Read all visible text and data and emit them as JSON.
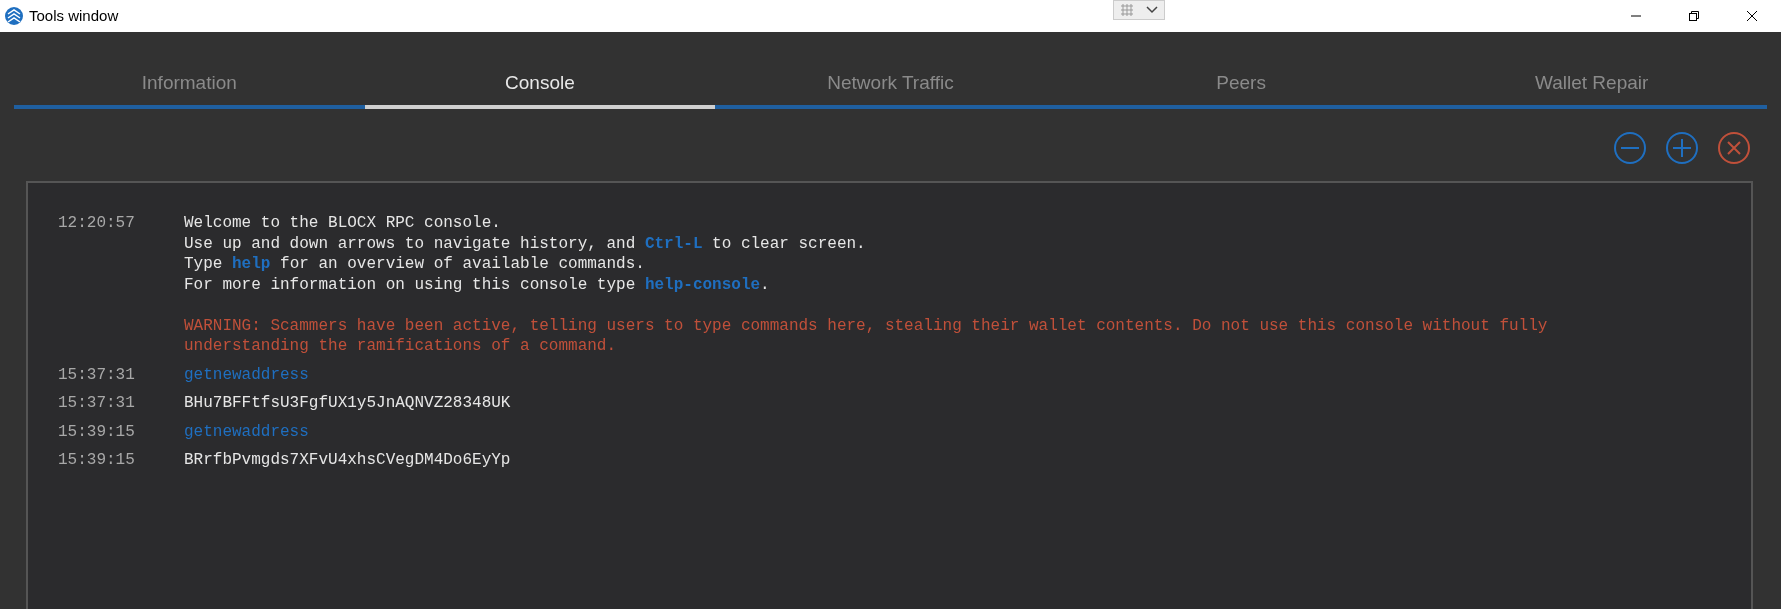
{
  "window": {
    "title": "Tools window"
  },
  "tabs": [
    {
      "label": "Information",
      "selected": false
    },
    {
      "label": "Console",
      "selected": true
    },
    {
      "label": "Network Traffic",
      "selected": false
    },
    {
      "label": "Peers",
      "selected": false
    },
    {
      "label": "Wallet Repair",
      "selected": false
    }
  ],
  "console": {
    "entries": [
      {
        "time": "12:20:57",
        "kind": "message",
        "paragraphs": [
          {
            "kind": "info",
            "lines": [
              [
                {
                  "text": "Welcome to the BLOCX RPC console.",
                  "kind": "plain"
                }
              ],
              [
                {
                  "text": "Use up and down arrows to navigate history, and ",
                  "kind": "plain"
                },
                {
                  "text": "Ctrl-L",
                  "kind": "keyword"
                },
                {
                  "text": " to clear screen.",
                  "kind": "plain"
                }
              ],
              [
                {
                  "text": "Type ",
                  "kind": "plain"
                },
                {
                  "text": "help",
                  "kind": "keyword"
                },
                {
                  "text": " for an overview of available commands.",
                  "kind": "plain"
                }
              ],
              [
                {
                  "text": "For more information on using this console type ",
                  "kind": "plain"
                },
                {
                  "text": "help-console",
                  "kind": "keyword"
                },
                {
                  "text": ".",
                  "kind": "plain"
                }
              ]
            ]
          },
          {
            "kind": "warning",
            "lines": [
              [
                {
                  "text": "WARNING: Scammers have been active, telling users to type commands here, stealing their wallet contents. Do not use this console without fully",
                  "kind": "plain"
                }
              ],
              [
                {
                  "text": "understanding the ramifications of a command.",
                  "kind": "plain"
                }
              ]
            ]
          }
        ]
      },
      {
        "time": "15:37:31",
        "kind": "command",
        "text": "getnewaddress"
      },
      {
        "time": "15:37:31",
        "kind": "result",
        "text": "BHu7BFFtfsU3FgfUX1y5JnAQNVZ28348UK"
      },
      {
        "time": "15:39:15",
        "kind": "command",
        "text": "getnewaddress"
      },
      {
        "time": "15:39:15",
        "kind": "result",
        "text": "BRrfbPvmgds7XFvU4xhsCVegDM4Do6EyYp"
      }
    ]
  }
}
